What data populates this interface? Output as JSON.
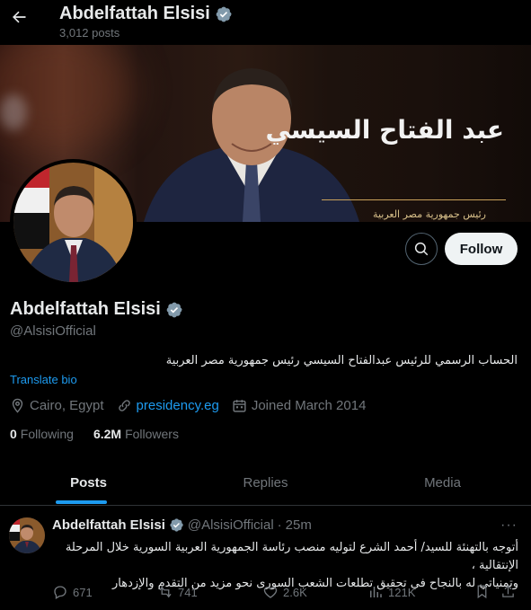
{
  "header": {
    "name": "Abdelfattah Elsisi",
    "posts_count": "3,012 posts"
  },
  "banner": {
    "arabic_name": "عبد الفتاح السيسي",
    "arabic_title": "رئيس جمهورية مصر العربية"
  },
  "profile": {
    "name": "Abdelfattah Elsisi",
    "handle": "@AlsisiOfficial",
    "bio": "الحساب الرسمي للرئيس عبدالفتاح السيسي رئيس جمهورية مصر العربية",
    "translate_label": "Translate bio",
    "location": "Cairo, Egypt",
    "website": "presidency.eg",
    "joined": "Joined March 2014",
    "following_count": "0",
    "following_label": "Following",
    "followers_count": "6.2M",
    "followers_label": "Followers",
    "follow_button": "Follow"
  },
  "tabs": [
    {
      "label": "Posts",
      "active": true
    },
    {
      "label": "Replies",
      "active": false
    },
    {
      "label": "Media",
      "active": false
    }
  ],
  "post": {
    "name": "Abdelfattah Elsisi",
    "handle": "@AlsisiOfficial",
    "separator": "·",
    "time": "25m",
    "more": "···",
    "text_line1": "أتوجه بالتهنئة للسيد/ أحمد الشرع لتوليه منصب رئاسة الجمهورية العربية السورية خلال المرحلة الإنتقالية ،",
    "text_line2": "وتمنياتي له بالنجاح في تحقيق تطلعات الشعب السورى نحو مزيد من التقدم والإزدهار",
    "replies": "671",
    "reposts": "741",
    "likes": "2.6K",
    "views": "121K"
  },
  "colors": {
    "background": "#000000",
    "accent": "#1d9bf0",
    "muted": "#71767b",
    "text": "#e7e9ea",
    "verified": "#829aab"
  },
  "icons": [
    "back-arrow-icon",
    "verified-badge-icon",
    "search-icon",
    "location-icon",
    "link-icon",
    "calendar-icon",
    "reply-icon",
    "repost-icon",
    "like-icon",
    "views-icon",
    "bookmark-icon",
    "share-icon",
    "more-icon"
  ]
}
